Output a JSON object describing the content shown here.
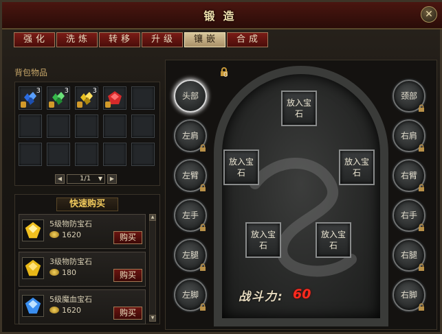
{
  "window": {
    "title": "锻造",
    "close_icon": "close-icon"
  },
  "tabs": [
    {
      "label": "强化",
      "active": false
    },
    {
      "label": "洗炼",
      "active": false
    },
    {
      "label": "转移",
      "active": false
    },
    {
      "label": "升级",
      "active": false
    },
    {
      "label": "镶嵌",
      "active": true
    },
    {
      "label": "合成",
      "active": false
    }
  ],
  "bag": {
    "label": "背包物品",
    "items": [
      {
        "icon": "blue-gem-cluster-icon",
        "count": "3",
        "color": "#2a6be0"
      },
      {
        "icon": "green-gem-cluster-icon",
        "count": "3",
        "color": "#35b84a"
      },
      {
        "icon": "yellow-gem-cluster-icon",
        "count": "3",
        "color": "#e8c020"
      },
      {
        "icon": "red-gem-icon",
        "count": "",
        "color": "#d62a2a"
      }
    ],
    "pager": {
      "page": "1/1"
    }
  },
  "quick_buy": {
    "title": "快速购买",
    "items": [
      {
        "name": "5级物防宝石",
        "price": "1620",
        "buy_label": "购买",
        "icon": "yellow-gem-icon",
        "color": "#f0c020"
      },
      {
        "name": "3级物防宝石",
        "price": "180",
        "buy_label": "购买",
        "icon": "yellow-gem-icon",
        "color": "#e8b818"
      },
      {
        "name": "5级魔血宝石",
        "price": "1620",
        "buy_label": "购买",
        "icon": "blue-gem-icon",
        "color": "#3a8ef0"
      }
    ]
  },
  "equip": {
    "badge_count": "0",
    "left_slots": [
      "头部",
      "左肩",
      "左臂",
      "左手",
      "左腿",
      "左脚"
    ],
    "right_slots": [
      "颈部",
      "右肩",
      "右臂",
      "右手",
      "右腿",
      "右脚"
    ],
    "gem_slot_label": "放入宝石",
    "power_label": "战斗力:",
    "power_value": "60"
  }
}
